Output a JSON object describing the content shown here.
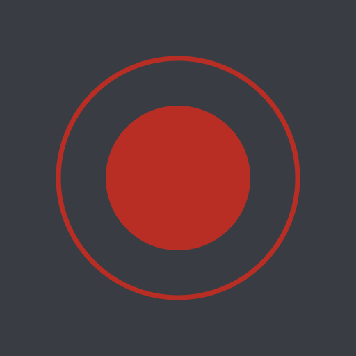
{
  "icon": {
    "name": "record-icon",
    "colors": {
      "background": "#393d43",
      "accent": "#b82e24"
    }
  }
}
